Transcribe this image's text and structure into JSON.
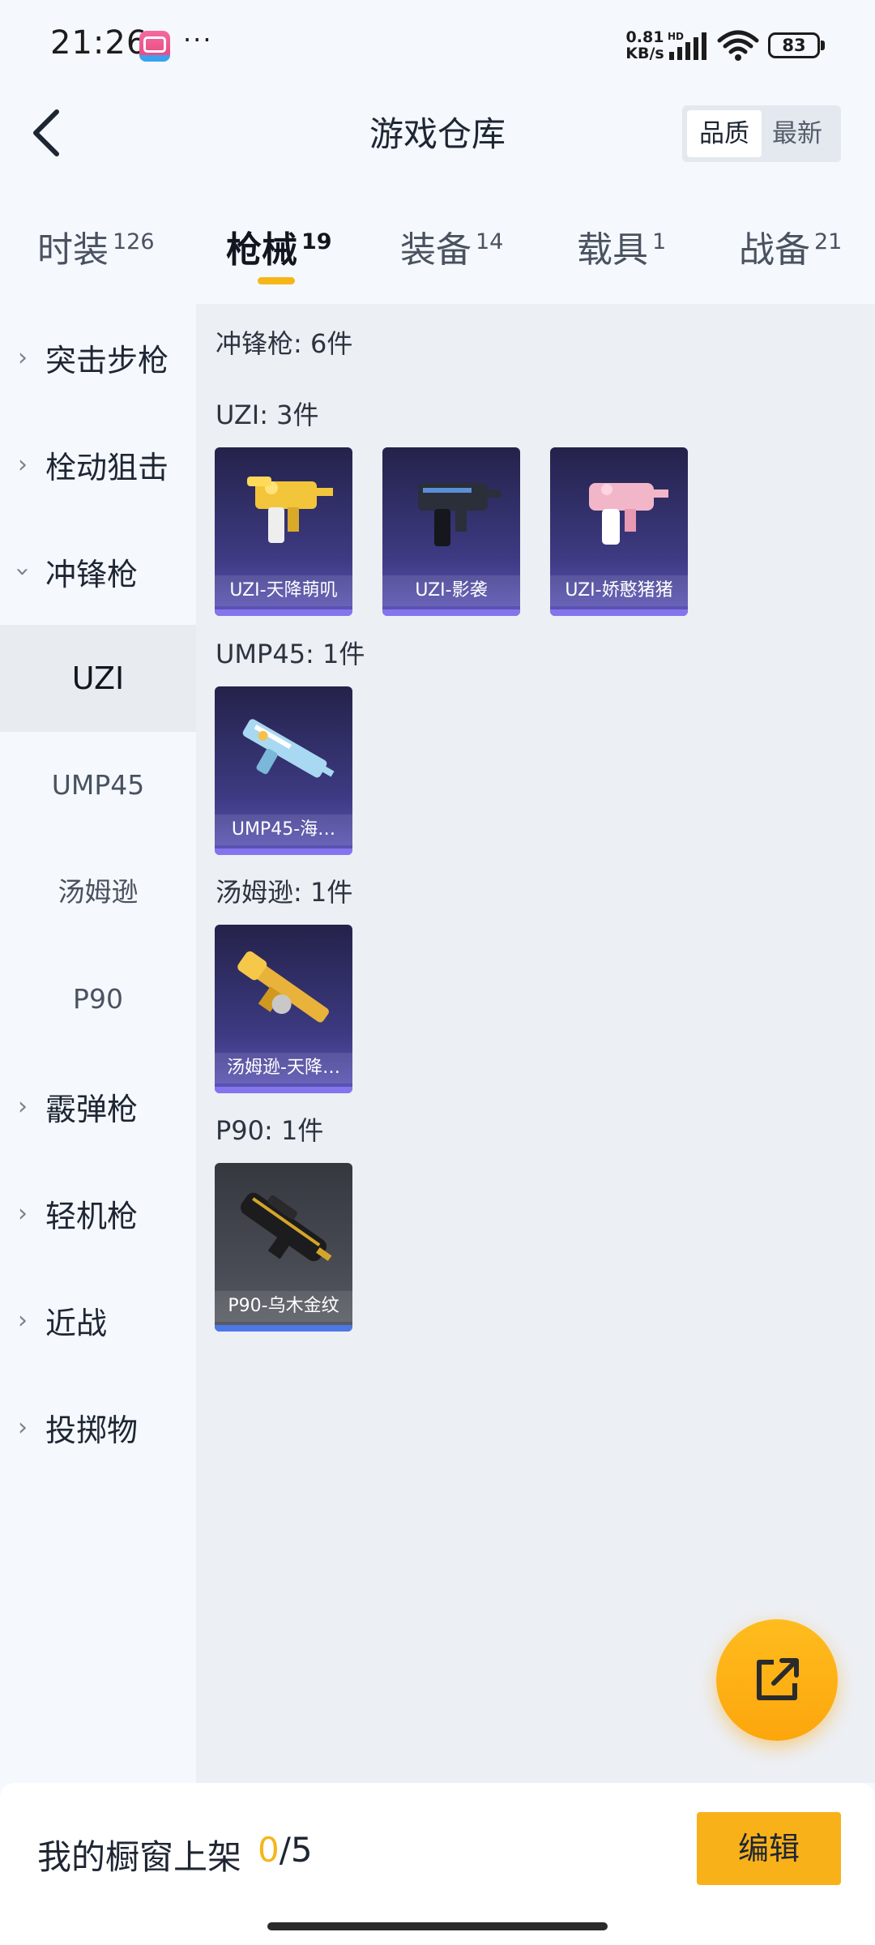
{
  "status_bar": {
    "time": "21:26",
    "dots": "···",
    "net_speed_value": "0.81",
    "net_speed_unit": "KB/s",
    "network_label": "HD",
    "battery": "83",
    "icons": [
      "bilibili-app-icon",
      "signal-icon",
      "wifi-icon",
      "battery-icon"
    ]
  },
  "header": {
    "title": "游戏仓库",
    "sort_options": [
      "品质",
      "最新"
    ],
    "sort_selected": "品质"
  },
  "tabs": [
    {
      "label": "时装",
      "count": "126"
    },
    {
      "label": "枪械",
      "count": "19"
    },
    {
      "label": "装备",
      "count": "14"
    },
    {
      "label": "载具",
      "count": "1"
    },
    {
      "label": "战备",
      "count": "21"
    }
  ],
  "active_tab": "枪械",
  "sidebar": {
    "items": [
      {
        "label": "突击步枪"
      },
      {
        "label": "栓动狙击"
      },
      {
        "label": "冲锋枪"
      },
      {
        "label": "霰弹枪"
      },
      {
        "label": "轻机枪"
      },
      {
        "label": "近战"
      },
      {
        "label": "投掷物"
      }
    ],
    "sub_items": [
      {
        "label": "UZI"
      },
      {
        "label": "UMP45"
      },
      {
        "label": "汤姆逊"
      },
      {
        "label": "P90"
      }
    ],
    "active_sub": "UZI"
  },
  "content": {
    "category_summary": "冲锋枪: 6件",
    "groups": [
      {
        "title": "UZI: 3件",
        "items": [
          "UZI-天降萌叽",
          "UZI-影袭",
          "UZI-娇憨猪猪"
        ]
      },
      {
        "title": "UMP45: 1件",
        "items": [
          "UMP45-海…"
        ]
      },
      {
        "title": "汤姆逊: 1件",
        "items": [
          "汤姆逊-天降…"
        ]
      },
      {
        "title": "P90: 1件",
        "items": [
          "P90-乌木金纹"
        ]
      }
    ]
  },
  "colors": {
    "accent": "#f9b11a",
    "card_purple": "#3d3a82",
    "card_grey": "#4b4e56",
    "rarity_purple": "#8474ee",
    "rarity_blue": "#4d77e6"
  },
  "bottom_bar": {
    "label": "我的橱窗上架",
    "current": "0",
    "separator": "/",
    "max": "5",
    "edit_label": "编辑"
  }
}
